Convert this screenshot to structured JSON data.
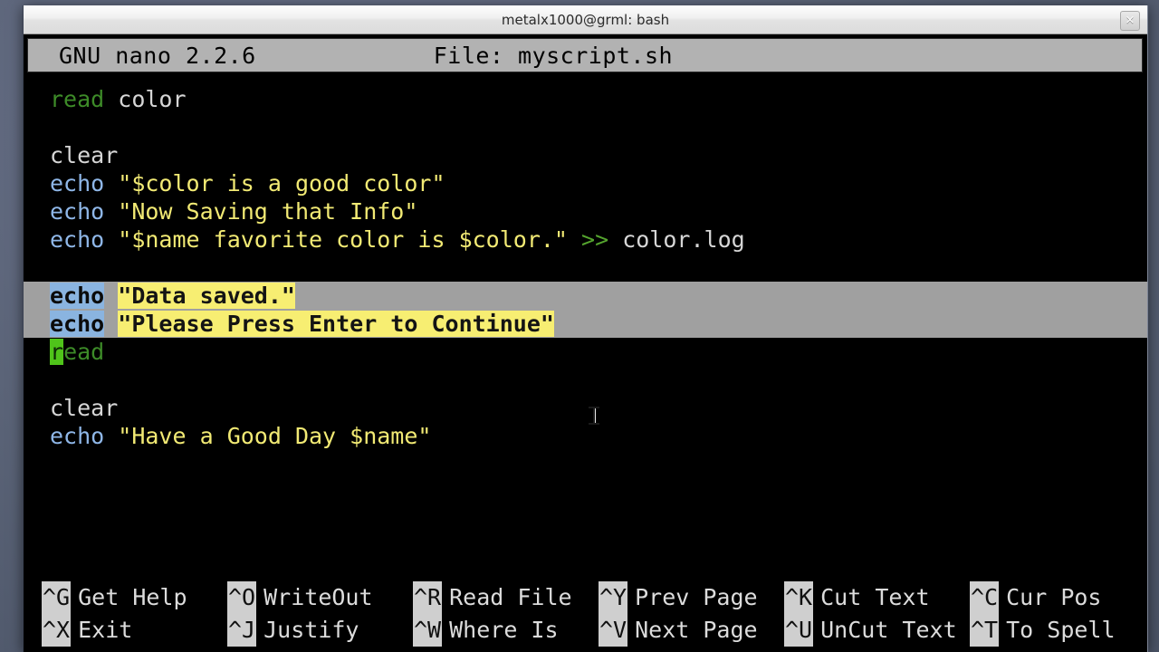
{
  "window": {
    "title": "metalx1000@grml: bash",
    "close_label": "×"
  },
  "nano": {
    "version_text": "GNU nano 2.2.6",
    "file_text": "File: myscript.sh"
  },
  "editor": {
    "lines": [
      {
        "id": "line-1",
        "tokens": [
          {
            "t": "read",
            "c": "kw-read"
          },
          {
            "t": " color",
            "c": "plain"
          }
        ]
      },
      {
        "id": "line-2",
        "tokens": [
          {
            "t": " ",
            "c": "plain"
          }
        ]
      },
      {
        "id": "line-3",
        "tokens": [
          {
            "t": "clear",
            "c": "plain"
          }
        ]
      },
      {
        "id": "line-4",
        "tokens": [
          {
            "t": "echo",
            "c": "kw-echo"
          },
          {
            "t": " ",
            "c": "plain"
          },
          {
            "t": "\"$color is a good color\"",
            "c": "str"
          }
        ]
      },
      {
        "id": "line-5",
        "tokens": [
          {
            "t": "echo",
            "c": "kw-echo"
          },
          {
            "t": " ",
            "c": "plain"
          },
          {
            "t": "\"Now Saving that Info\"",
            "c": "str"
          }
        ]
      },
      {
        "id": "line-6",
        "tokens": [
          {
            "t": "echo",
            "c": "kw-echo"
          },
          {
            "t": " ",
            "c": "plain"
          },
          {
            "t": "\"$name favorite color is $color.\"",
            "c": "str"
          },
          {
            "t": " ",
            "c": "plain"
          },
          {
            "t": ">>",
            "c": "redir"
          },
          {
            "t": " color.log",
            "c": "plain"
          }
        ]
      },
      {
        "id": "line-7",
        "tokens": [
          {
            "t": " ",
            "c": "plain"
          }
        ]
      },
      {
        "id": "line-8",
        "selected": true,
        "tokens": [
          {
            "t": "echo",
            "c": "kw-echo"
          },
          {
            "t": " ",
            "c": "plain"
          },
          {
            "t": "\"Data saved.\"",
            "c": "str"
          }
        ]
      },
      {
        "id": "line-9",
        "selected": true,
        "tokens": [
          {
            "t": "echo",
            "c": "kw-echo"
          },
          {
            "t": " ",
            "c": "plain"
          },
          {
            "t": "\"Please Press Enter to Continue\"",
            "c": "str"
          }
        ]
      },
      {
        "id": "line-10",
        "cursor": true,
        "tokens": [
          {
            "t": "r",
            "c": "kw-read cursor-char"
          },
          {
            "t": "ead",
            "c": "kw-read"
          }
        ]
      },
      {
        "id": "line-11",
        "tokens": [
          {
            "t": " ",
            "c": "plain"
          }
        ]
      },
      {
        "id": "line-12",
        "tokens": [
          {
            "t": "clear",
            "c": "plain"
          }
        ]
      },
      {
        "id": "line-13",
        "tokens": [
          {
            "t": "echo",
            "c": "kw-echo"
          },
          {
            "t": " ",
            "c": "plain"
          },
          {
            "t": "\"Have a Good Day $name\"",
            "c": "str"
          }
        ]
      }
    ]
  },
  "shortcuts": {
    "row1": [
      {
        "key": "^G",
        "label": "Get Help",
        "name": "get-help"
      },
      {
        "key": "^O",
        "label": "WriteOut",
        "name": "writeout"
      },
      {
        "key": "^R",
        "label": "Read File",
        "name": "read-file"
      },
      {
        "key": "^Y",
        "label": "Prev Page",
        "name": "prev-page"
      },
      {
        "key": "^K",
        "label": "Cut Text",
        "name": "cut-text"
      },
      {
        "key": "^C",
        "label": "Cur Pos",
        "name": "cur-pos"
      }
    ],
    "row2": [
      {
        "key": "^X",
        "label": "Exit",
        "name": "exit"
      },
      {
        "key": "^J",
        "label": "Justify",
        "name": "justify"
      },
      {
        "key": "^W",
        "label": "Where Is",
        "name": "where-is"
      },
      {
        "key": "^V",
        "label": "Next Page",
        "name": "next-page"
      },
      {
        "key": "^U",
        "label": "UnCut Text",
        "name": "uncut-text"
      },
      {
        "key": "^T",
        "label": "To Spell",
        "name": "to-spell"
      }
    ]
  },
  "colors": {
    "terminal_bg": "#000000",
    "keyword_read": "#3d8b28",
    "keyword_echo": "#8fb7e8",
    "string": "#f2ea74",
    "redirect": "#55a52e",
    "plain_text": "#d6d6d6",
    "selection_bg": "#a0a0a0",
    "cursor_block": "#4fc41a",
    "nano_bar_bg": "#b2b2b2",
    "shortcut_key_bg": "#cfcfcf",
    "desktop_bg": "#5b6478"
  }
}
